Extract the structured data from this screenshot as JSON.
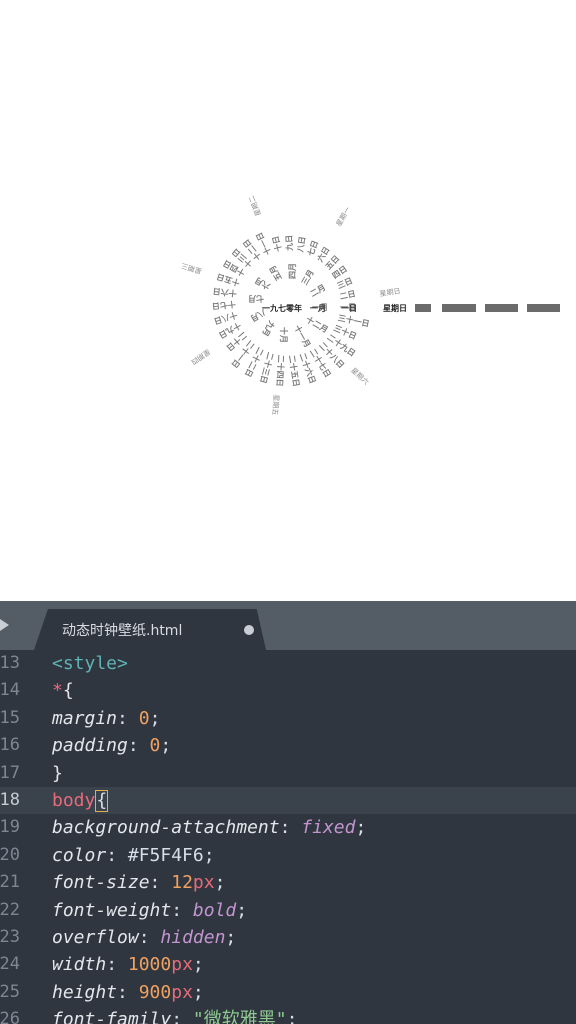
{
  "preview": {
    "center": {
      "year": "一九七零年",
      "month": "一月",
      "day": "一日"
    },
    "weekday": "星期日",
    "months": [
      "一月",
      "二月",
      "三月",
      "四月",
      "五月",
      "六月",
      "七月",
      "八月",
      "九月",
      "十月",
      "十一月",
      "十二月"
    ],
    "days": [
      "一日",
      "二日",
      "三日",
      "四日",
      "五日",
      "六日",
      "七日",
      "八日",
      "九日",
      "十日",
      "十一日",
      "十二日",
      "十三日",
      "十四日",
      "十五日",
      "十六日",
      "十七日",
      "十八日",
      "十九日",
      "二十日",
      "二十一日",
      "二十二日",
      "二十三日",
      "二十四日",
      "二十五日",
      "二十六日",
      "二十七日",
      "二十八日",
      "二十九日",
      "三十日",
      "三十一日"
    ],
    "weekdays": [
      "星期一",
      "星期二",
      "星期三",
      "星期四",
      "星期五",
      "星期六",
      "星期日"
    ]
  },
  "editor": {
    "tab_title": "动态时钟壁纸.html",
    "current_line": "18",
    "lines": [
      {
        "n": "13",
        "tokens": [
          [
            "tag",
            "<style>"
          ]
        ]
      },
      {
        "n": "14",
        "tokens": [
          [
            "sel",
            "*"
          ],
          [
            "brk",
            "{"
          ]
        ]
      },
      {
        "n": "15",
        "tokens": [
          [
            "prop",
            "margin"
          ],
          [
            "plain",
            ": "
          ],
          [
            "num",
            "0"
          ],
          [
            "plain",
            ";"
          ]
        ]
      },
      {
        "n": "16",
        "tokens": [
          [
            "prop",
            "padding"
          ],
          [
            "plain",
            ": "
          ],
          [
            "num",
            "0"
          ],
          [
            "plain",
            ";"
          ]
        ]
      },
      {
        "n": "17",
        "tokens": [
          [
            "brk",
            "}"
          ]
        ]
      },
      {
        "n": "18",
        "tokens": [
          [
            "sel",
            "body"
          ],
          [
            "cursor",
            "{"
          ]
        ]
      },
      {
        "n": "19",
        "tokens": [
          [
            "prop",
            "background-attachment"
          ],
          [
            "plain",
            ": "
          ],
          [
            "kw",
            "fixed"
          ],
          [
            "plain",
            ";"
          ]
        ]
      },
      {
        "n": "20",
        "tokens": [
          [
            "prop",
            "color"
          ],
          [
            "plain",
            ": "
          ],
          [
            "plain",
            "#F5F4F6"
          ],
          [
            "plain",
            ";"
          ]
        ]
      },
      {
        "n": "21",
        "tokens": [
          [
            "prop",
            "font-size"
          ],
          [
            "plain",
            ": "
          ],
          [
            "num",
            "12"
          ],
          [
            "unit",
            "px"
          ],
          [
            "plain",
            ";"
          ]
        ]
      },
      {
        "n": "22",
        "tokens": [
          [
            "prop",
            "font-weight"
          ],
          [
            "plain",
            ": "
          ],
          [
            "kw",
            "bold"
          ],
          [
            "plain",
            ";"
          ]
        ]
      },
      {
        "n": "23",
        "tokens": [
          [
            "prop",
            "overflow"
          ],
          [
            "plain",
            ": "
          ],
          [
            "kw",
            "hidden"
          ],
          [
            "plain",
            ";"
          ]
        ]
      },
      {
        "n": "24",
        "tokens": [
          [
            "prop",
            "width"
          ],
          [
            "plain",
            ": "
          ],
          [
            "num",
            "1000"
          ],
          [
            "unit",
            "px"
          ],
          [
            "plain",
            ";"
          ]
        ]
      },
      {
        "n": "25",
        "tokens": [
          [
            "prop",
            "height"
          ],
          [
            "plain",
            ": "
          ],
          [
            "num",
            "900"
          ],
          [
            "unit",
            "px"
          ],
          [
            "plain",
            ";"
          ]
        ]
      },
      {
        "n": "26",
        "tokens": [
          [
            "prop",
            "font-family"
          ],
          [
            "plain",
            ": "
          ],
          [
            "str",
            "\"微软雅黑\""
          ],
          [
            "plain",
            ";"
          ]
        ]
      }
    ]
  }
}
